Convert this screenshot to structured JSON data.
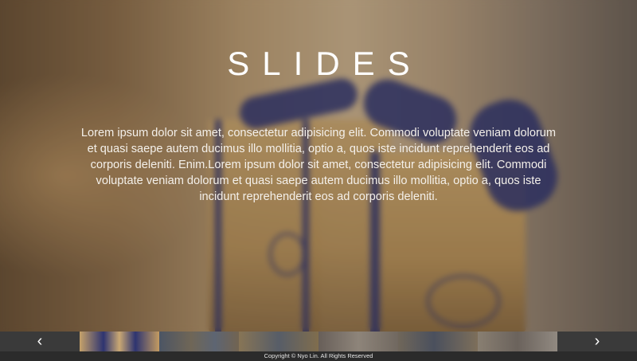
{
  "slide": {
    "title": "SLIDES",
    "body": "Lorem ipsum dolor sit amet, consectetur adipisicing elit. Commodi voluptate veniam dolorum et quasi saepe autem ducimus illo mollitia, optio a, quos iste incidunt reprehenderit eos ad corporis deleniti. Enim.Lorem ipsum dolor sit amet, consectetur adipisicing elit. Commodi voluptate veniam dolorum et quasi saepe autem ducimus illo mollitia, optio a, quos iste incidunt reprehenderit eos ad corporis deleniti."
  },
  "nav": {
    "prev_icon": "chevron-left-icon",
    "prev_glyph": "‹",
    "next_icon": "chevron-right-icon",
    "next_glyph": "›"
  },
  "thumbnails": {
    "count": 6,
    "active_index": 0
  },
  "footer": {
    "copyright": "Copyright © Nyo Lin. All Rights Reserved"
  },
  "colors": {
    "thumbbar_bg": "#3a3a3a",
    "footer_bg": "#2b2b2b",
    "ribbon_blue": "#2e3470",
    "text": "#ffffff"
  }
}
